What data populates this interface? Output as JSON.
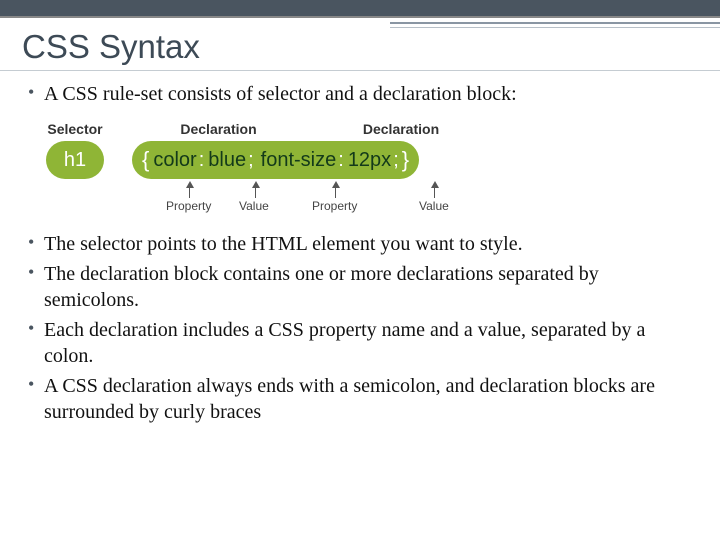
{
  "title": "CSS Syntax",
  "bullets": [
    "A CSS rule-set consists of selector and a declaration block:",
    "The selector points to the HTML element you want to style.",
    "The declaration block contains one or more declarations separated by semicolons.",
    "Each declaration includes a CSS property name and a value, separated by a colon.",
    "A CSS declaration always ends with a semicolon, and declaration blocks are surrounded by curly braces"
  ],
  "diagram": {
    "topLabels": {
      "selector": "Selector",
      "decl1": "Declaration",
      "decl2": "Declaration"
    },
    "selector": "h1",
    "braceOpen": "{",
    "braceClose": "}",
    "decl1": {
      "prop": "color",
      "colon": ":",
      "val": "blue",
      "semi": ";"
    },
    "decl2": {
      "prop": "font-size",
      "colon": ":",
      "val": "12px",
      "semi": ";"
    },
    "bottomLabels": {
      "prop": "Property",
      "val": "Value"
    }
  }
}
